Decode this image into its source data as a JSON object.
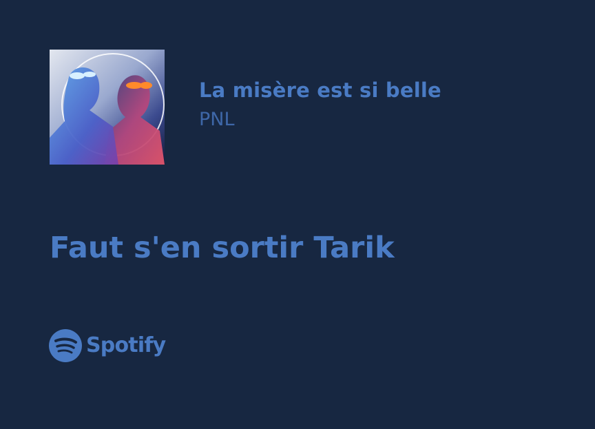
{
  "track": {
    "title": "La misère est si belle",
    "artist": "PNL"
  },
  "lyric": {
    "line": "Faut s'en sortir Tarik"
  },
  "brand": {
    "name": "Spotify",
    "logo_icon": "spotify-logo-icon"
  },
  "album_art": {
    "icon": "album-cover-image"
  },
  "colors": {
    "background": "#172741",
    "accent": "#4a7bc4",
    "secondary": "#3e67a8"
  }
}
